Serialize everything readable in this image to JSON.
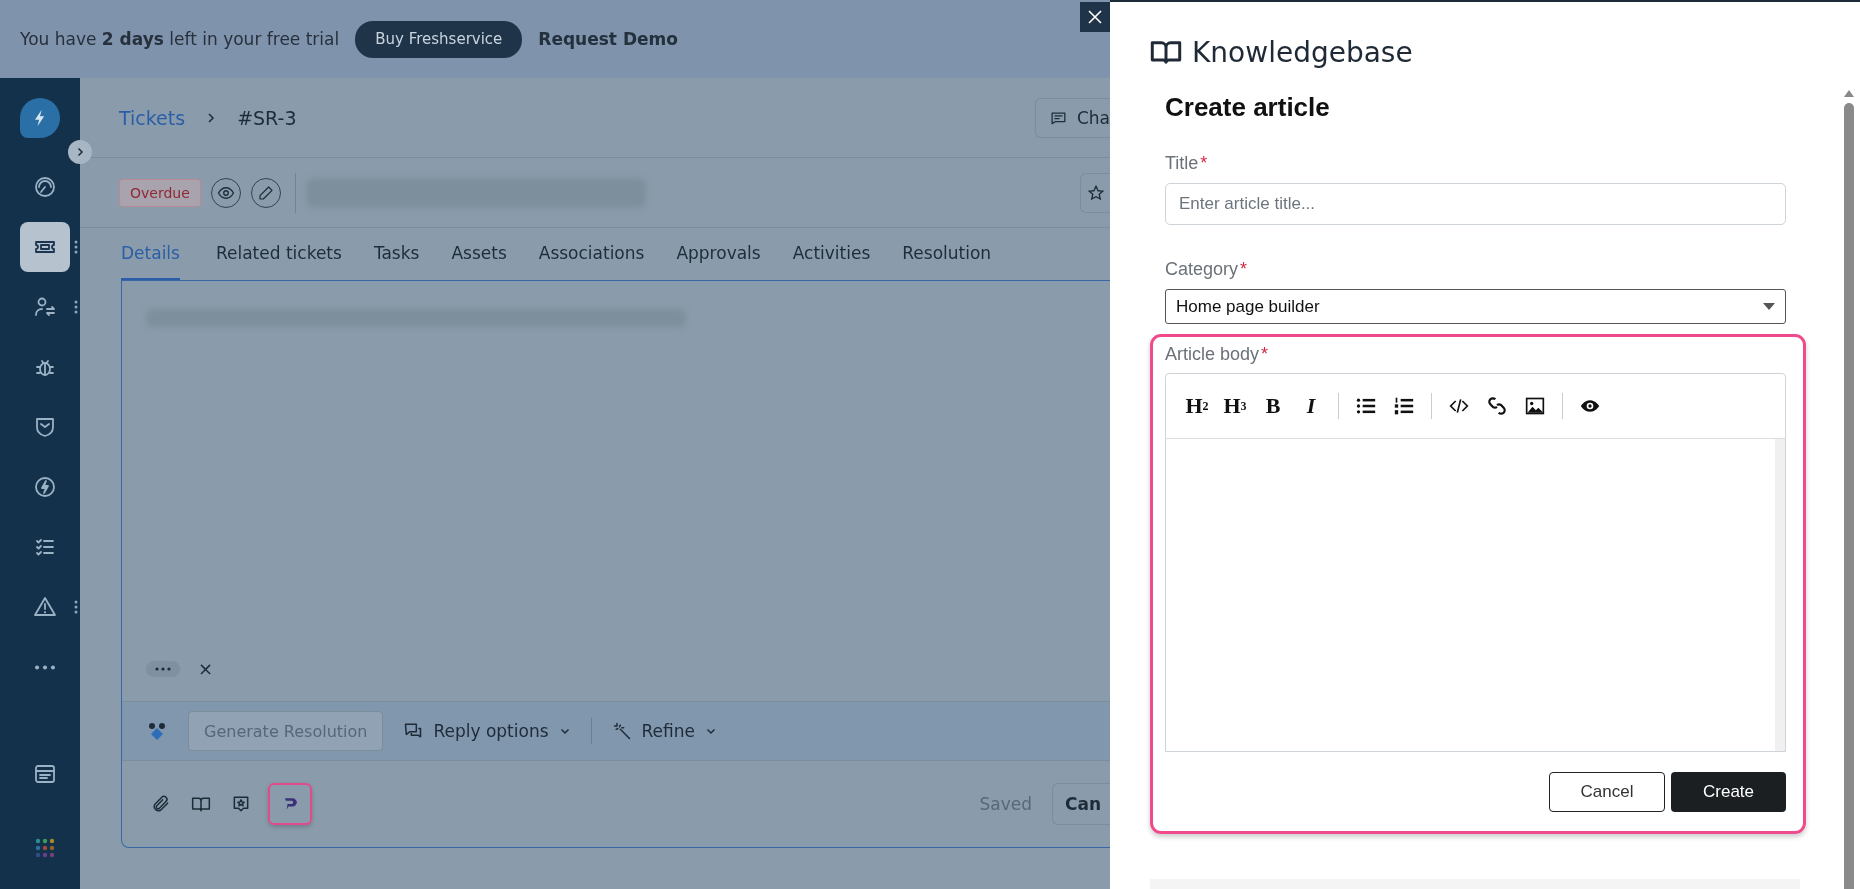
{
  "trial_banner": {
    "text": "You have **2 days** left in your free trial",
    "buy_button": "Buy Freshservice",
    "demo_link": "Request Demo"
  },
  "sidebar": {
    "items": [
      {
        "kind": "dashboard",
        "selected": false,
        "menu": false
      },
      {
        "kind": "tickets",
        "selected": true,
        "menu": true
      },
      {
        "kind": "changes",
        "selected": false,
        "menu": true
      },
      {
        "kind": "bug",
        "selected": false,
        "menu": false
      },
      {
        "kind": "shield",
        "selected": false,
        "menu": false
      },
      {
        "kind": "bolt",
        "selected": false,
        "menu": false
      },
      {
        "kind": "tasks",
        "selected": false,
        "menu": false
      },
      {
        "kind": "warning",
        "selected": false,
        "menu": true
      },
      {
        "kind": "more",
        "selected": false,
        "menu": false
      }
    ],
    "bottom_items": [
      {
        "kind": "window",
        "selected": false
      },
      {
        "kind": "apps",
        "selected": false
      }
    ]
  },
  "breadcrumb": {
    "parent": "Tickets",
    "current": "#SR-3"
  },
  "header_button": "Cha",
  "ticket": {
    "status": "Overdue"
  },
  "tabs": [
    {
      "label": "Details",
      "selected": true
    },
    {
      "label": "Related tickets",
      "selected": false
    },
    {
      "label": "Tasks",
      "selected": false
    },
    {
      "label": "Assets",
      "selected": false
    },
    {
      "label": "Associations",
      "selected": false
    },
    {
      "label": "Approvals",
      "selected": false
    },
    {
      "label": "Activities",
      "selected": false
    },
    {
      "label": "Resolution",
      "selected": false
    }
  ],
  "editor": {
    "close_mark": "×",
    "ai_bar": {
      "generate": "Generate Resolution",
      "generate_disabled": true,
      "reply_options": "Reply options",
      "refine": "Refine"
    },
    "tools": [
      {
        "kind": "attach",
        "highlighted": false
      },
      {
        "kind": "book",
        "highlighted": false
      },
      {
        "kind": "star-note",
        "highlighted": false
      },
      {
        "kind": "app",
        "highlighted": true
      }
    ],
    "status": "Saved",
    "cancel": "Can"
  },
  "panel": {
    "title": "Knowledgebase",
    "heading": "Create article",
    "fields": [
      {
        "kind": "text",
        "label": "Title",
        "required_mark": "*",
        "placeholder": "Enter article title..."
      },
      {
        "kind": "select",
        "label": "Category",
        "required_mark": "*",
        "value": "Home page builder"
      }
    ],
    "body": {
      "label": "Article body",
      "required_mark": "*",
      "highlighted": true,
      "toolbar": [
        [
          {
            "kind": "heading",
            "label": "H$^{2}$"
          },
          {
            "kind": "heading",
            "label": "H$^{3}$"
          },
          {
            "kind": "bold",
            "label": "B"
          },
          {
            "kind": "italic",
            "label": "I"
          }
        ],
        [
          {
            "kind": "bullet-list"
          },
          {
            "kind": "numbered-list"
          }
        ],
        [
          {
            "kind": "code"
          },
          {
            "kind": "link"
          },
          {
            "kind": "image"
          }
        ],
        [
          {
            "kind": "eye"
          }
        ]
      ]
    },
    "buttons": {
      "cancel": "Cancel",
      "create": "Create"
    }
  }
}
